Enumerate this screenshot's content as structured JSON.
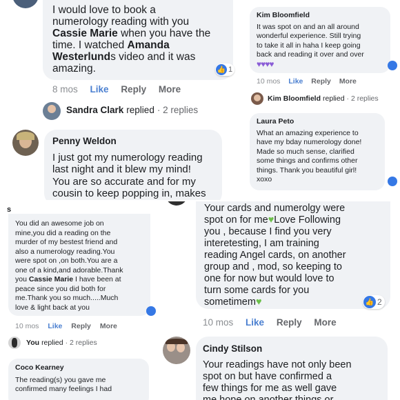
{
  "p1": {
    "comment": {
      "l1": "I would love to book a",
      "l2": "numerology reading with you",
      "l3_name": "Cassie Marie",
      "l3_rest": " when you have the",
      "l4_pre": "time. I watched ",
      "l4_name": "Amanda",
      "l5_name": "Westerlund",
      "l5_rest": "s video and it was",
      "l6": "amazing."
    },
    "react_count": "1",
    "time": "8 mos",
    "like": "Like",
    "reply": "Reply",
    "more": "More",
    "replied_name": "Sandra Clark",
    "replied_text": "replied",
    "replies": "· 2 replies",
    "second": {
      "name": "Penny Weldon",
      "l1": "I just got my numerology reading",
      "l2": "last night and it blew my mind!",
      "l3": "You are so accurate and for my",
      "l4": "cousin to keep popping in, makes"
    }
  },
  "p2": {
    "first": {
      "name": "Kim Bloomfield",
      "l1": "It was spot on and an all around",
      "l2": "wonderful experience. Still trying",
      "l3": "to take it all in haha I keep going",
      "l4": "back and reading it over and over"
    },
    "time": "10 mos",
    "like": "Like",
    "reply": "Reply",
    "more": "More",
    "replied_name": "Kim Bloomfield",
    "replied_text": "replied",
    "replies": "· 2 replies",
    "second": {
      "name": "Laura Peto",
      "l1": "What an amazing experience to",
      "l2": "have my bday numerology done!",
      "l3": "Made so much sense, clarified",
      "l4": "some things and confirms other",
      "l5": "things. Thank you beautiful girl!",
      "l6": "xoxo"
    }
  },
  "p3": {
    "partial_name": "s",
    "comment": {
      "l1": "You did an awesome job on",
      "l2": "mine,you did a reading on the",
      "l3": "murder of my bestest friend and",
      "l4": "also a numerology reading.You",
      "l5": "were spot on ,on both.You are a",
      "l6": "one of a kind,and adorable.Thank",
      "l7_pre": "you ",
      "l7_name": "Cassie Marie",
      "l7_rest": " I have been at",
      "l8": "peace since you did both for",
      "l9": "me.Thank you so much.....Much",
      "l10": "love & light back at you"
    },
    "time": "10 mos",
    "like": "Like",
    "reply": "Reply",
    "more": "More",
    "replied_name": "You",
    "replied_text": "replied",
    "replies": "· 2 replies",
    "second": {
      "name": "Coco Kearney",
      "l1": "The reading(s) you gave me",
      "l2": "confirmed many feelings I had"
    }
  },
  "p4": {
    "comment": {
      "l1": "Your cards and numerolgy were",
      "l2_pre": "spot on for me",
      "l2_post": "Love Following",
      "l3": "you , because I find you very",
      "l4": "interetesting, I am training",
      "l5": "reading Angel cards, on another",
      "l6": "group and , mod, so keeping to",
      "l7": "one for now but would love to",
      "l8": "turn some cards for you",
      "l9": "sometimem"
    },
    "react_count": "2",
    "time": "10 mos",
    "like": "Like",
    "reply": "Reply",
    "more": "More",
    "second": {
      "name": "Cindy Stilson",
      "l1": "Your readings have not only been",
      "l2": "spot on but have confirmed a",
      "l3": "few things for me as well gave",
      "l4": "me hope on another things or"
    }
  },
  "colors": {
    "bubble": "#f0f2f5",
    "like_blue": "#4a7fd0",
    "meta_gray": "#65676b",
    "badge_blue": "#3578e5"
  }
}
